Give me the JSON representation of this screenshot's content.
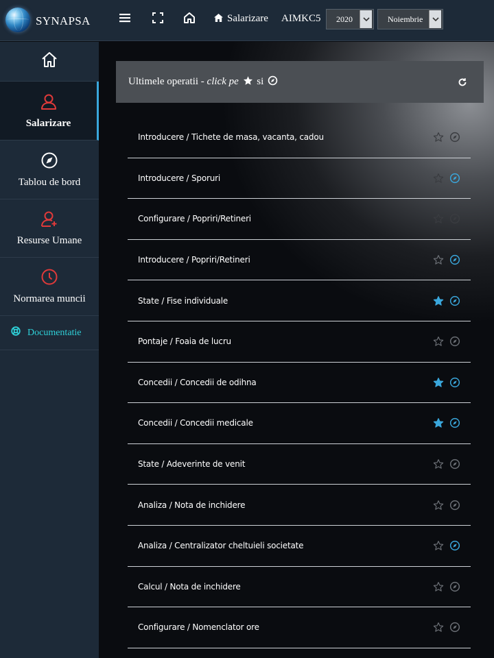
{
  "header": {
    "brand": "SYNAPSA",
    "link_label": "Salarizare",
    "company": "AIMKC5",
    "year_value": "2020",
    "month_value": "Noiembrie"
  },
  "sidebar": {
    "items": [
      {
        "label": "",
        "icon": "home-icon"
      },
      {
        "label": "Salarizare",
        "icon": "user-icon",
        "active": true
      },
      {
        "label": "Tablou de bord",
        "icon": "compass-icon"
      },
      {
        "label": "Resurse Umane",
        "icon": "user-add-icon"
      },
      {
        "label": "Normarea muncii",
        "icon": "clock-icon"
      }
    ],
    "doc_label": "Documentatie"
  },
  "panel": {
    "title_prefix": "Ultimele operatii - ",
    "title_click": "click pe",
    "title_si": "si"
  },
  "colors": {
    "accent": "#3aa7dc",
    "doc": "#2fd0d8",
    "danger": "#e03a3a",
    "inactive": "#6b6f75"
  },
  "operations": [
    {
      "label": "Introducere / Tichete de masa, vacanta, cadou",
      "starred": false,
      "compass": false,
      "faded": true
    },
    {
      "label": "Introducere / Sporuri",
      "starred": false,
      "compass": true,
      "faded": true
    },
    {
      "label": "Configurare / Popriri/Retineri",
      "starred": false,
      "compass": false,
      "faded": true
    },
    {
      "label": "Introducere / Popriri/Retineri",
      "starred": false,
      "compass": true,
      "faded": false
    },
    {
      "label": "State / Fise individuale",
      "starred": true,
      "compass": true,
      "faded": false
    },
    {
      "label": "Pontaje / Foaia de lucru",
      "starred": false,
      "compass": false,
      "faded": false
    },
    {
      "label": "Concedii / Concedii de odihna",
      "starred": true,
      "compass": true,
      "faded": false
    },
    {
      "label": "Concedii / Concedii medicale",
      "starred": true,
      "compass": true,
      "faded": false
    },
    {
      "label": "State / Adeverinte de venit",
      "starred": false,
      "compass": false,
      "faded": false
    },
    {
      "label": "Analiza / Nota de inchidere",
      "starred": false,
      "compass": false,
      "faded": false
    },
    {
      "label": "Analiza / Centralizator cheltuieli societate",
      "starred": false,
      "compass": true,
      "faded": false
    },
    {
      "label": "Calcul / Nota de inchidere",
      "starred": false,
      "compass": false,
      "faded": false
    },
    {
      "label": "Configurare / Nomenclator ore",
      "starred": false,
      "compass": false,
      "faded": false
    }
  ]
}
